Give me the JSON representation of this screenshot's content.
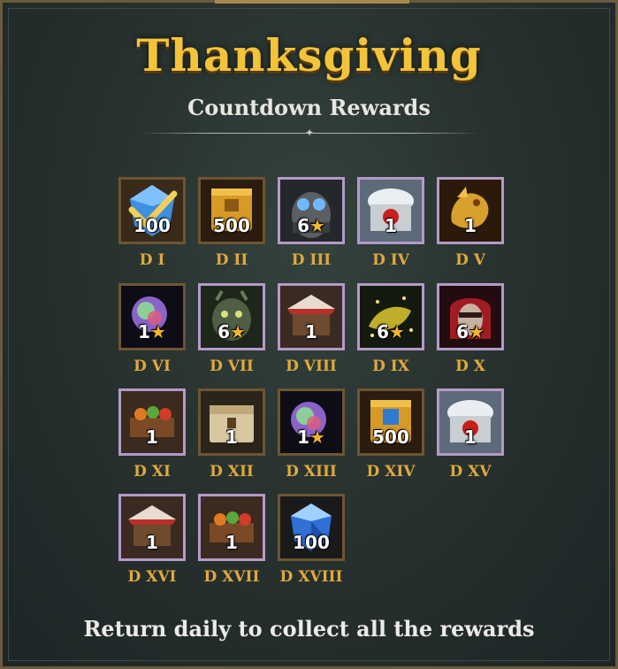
{
  "header": {
    "title": "Thanksgiving",
    "subtitle": "Countdown Rewards"
  },
  "rewards": [
    {
      "day": "D I",
      "qty": "100",
      "star": false,
      "item": "gem-checkmark-icon",
      "frame": "gold"
    },
    {
      "day": "D II",
      "qty": "500",
      "star": false,
      "item": "gold-crate-icon",
      "frame": "gold"
    },
    {
      "day": "D III",
      "qty": "6",
      "star": true,
      "item": "hero-goggles-portrait-icon",
      "frame": "purple"
    },
    {
      "day": "D IV",
      "qty": "1",
      "star": false,
      "item": "snowy-lantern-building-icon",
      "frame": "purple"
    },
    {
      "day": "D V",
      "qty": "1",
      "star": false,
      "item": "golden-dragon-icon",
      "frame": "purple"
    },
    {
      "day": "D VI",
      "qty": "1",
      "star": true,
      "item": "rainbow-orb-icon",
      "frame": "gold"
    },
    {
      "day": "D VII",
      "qty": "6",
      "star": true,
      "item": "forest-beast-portrait-icon",
      "frame": "purple"
    },
    {
      "day": "D VIII",
      "qty": "1",
      "star": false,
      "item": "market-stall-icon",
      "frame": "purple"
    },
    {
      "day": "D IX",
      "qty": "6",
      "star": true,
      "item": "golden-sparkle-beast-icon",
      "frame": "purple"
    },
    {
      "day": "D X",
      "qty": "6",
      "star": true,
      "item": "masked-warrior-portrait-icon",
      "frame": "purple"
    },
    {
      "day": "D XI",
      "qty": "1",
      "star": false,
      "item": "vegetable-cart-icon",
      "frame": "purple"
    },
    {
      "day": "D XII",
      "qty": "1",
      "star": false,
      "item": "ornate-chest-icon",
      "frame": "gold"
    },
    {
      "day": "D XIII",
      "qty": "1",
      "star": true,
      "item": "rainbow-orb-icon",
      "frame": "gold"
    },
    {
      "day": "D XIV",
      "qty": "500",
      "star": false,
      "item": "gold-crate-blue-icon",
      "frame": "gold"
    },
    {
      "day": "D XV",
      "qty": "1",
      "star": false,
      "item": "snowy-lantern-building-icon",
      "frame": "purple"
    },
    {
      "day": "D XVI",
      "qty": "1",
      "star": false,
      "item": "market-stall-icon",
      "frame": "purple"
    },
    {
      "day": "D XVII",
      "qty": "1",
      "star": false,
      "item": "vegetable-cart-icon",
      "frame": "purple"
    },
    {
      "day": "D XVIII",
      "qty": "100",
      "star": false,
      "item": "blue-gem-icon",
      "frame": "gold"
    }
  ],
  "footer": {
    "message": "Return daily to collect all the rewards"
  },
  "colors": {
    "title": "#f3c43a",
    "day_label": "#e0a93a",
    "star": "#f2b72b",
    "frame_gold": "#6e5532",
    "frame_purple": "#b49ac7"
  }
}
